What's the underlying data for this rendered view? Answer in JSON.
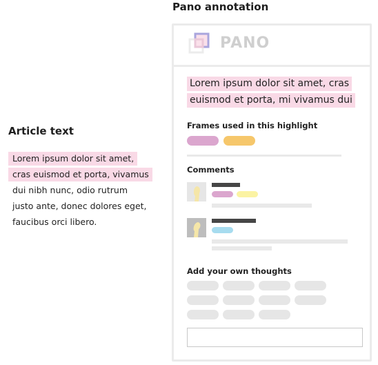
{
  "article": {
    "heading": "Article text",
    "lines": [
      {
        "text": "Lorem ipsum dolor sit amet,",
        "highlighted": true
      },
      {
        "text": "cras euismod et porta, vivamus",
        "highlighted": true
      },
      {
        "text": "dui nibh nunc, odio rutrum",
        "highlighted": false
      },
      {
        "text": "justo ante, donec dolores eget,",
        "highlighted": false
      },
      {
        "text": "faucibus orci libero.",
        "highlighted": false
      }
    ]
  },
  "pano": {
    "heading": "Pano annotation",
    "logo_text": "PANO",
    "quote_lines": [
      "Lorem ipsum dolor sit amet, cras",
      "euismod et porta, mi vivamus dui"
    ],
    "frames_title": "Frames used in this highlight",
    "comments_title": "Comments",
    "add_thoughts_title": "Add your own thoughts"
  },
  "colors": {
    "highlight": "#f9d9e6",
    "frame_pink": "#dba6ce",
    "frame_orange": "#f6c76b",
    "frame_yellow": "#fbf3a3",
    "frame_blue": "#a7dcef",
    "placeholder_gray": "#e9e9e9",
    "dark_bar": "#464646"
  }
}
